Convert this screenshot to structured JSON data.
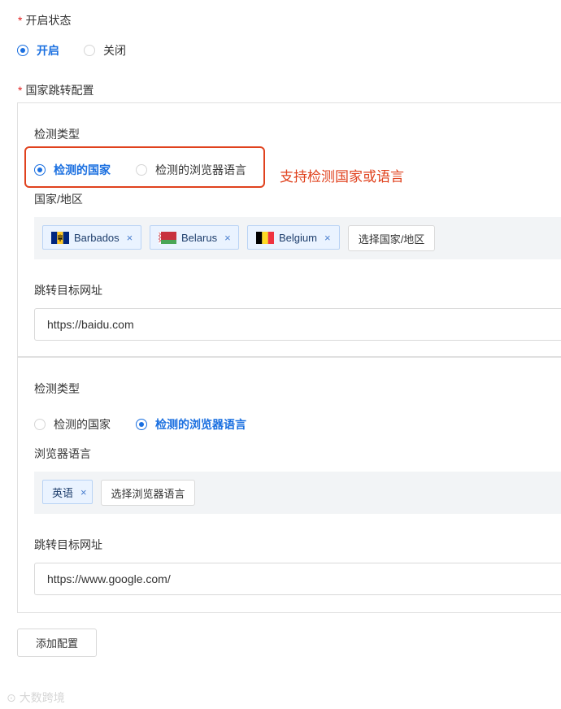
{
  "status_section": {
    "required_mark": "*",
    "label": "开启状态",
    "options": [
      {
        "label": "开启",
        "checked": true
      },
      {
        "label": "关闭",
        "checked": false
      }
    ]
  },
  "country_jump_section": {
    "required_mark": "*",
    "label": "国家跳转配置"
  },
  "configs": [
    {
      "detect_type_label": "检测类型",
      "detect_options": [
        {
          "label": "检测的国家",
          "checked": true
        },
        {
          "label": "检测的浏览器语言",
          "checked": false
        }
      ],
      "selection_label": "国家/地区",
      "tags": [
        {
          "label": "Barbados",
          "flag_icon": "barbados-flag-icon",
          "close": "×"
        },
        {
          "label": "Belarus",
          "flag_icon": "belarus-flag-icon",
          "close": "×"
        },
        {
          "label": "Belgium",
          "flag_icon": "belgium-flag-icon",
          "close": "×"
        }
      ],
      "select_button": "选择国家/地区",
      "target_url_label": "跳转目标网址",
      "target_url_value": "https://baidu.com"
    },
    {
      "detect_type_label": "检测类型",
      "detect_options": [
        {
          "label": "检测的国家",
          "checked": false
        },
        {
          "label": "检测的浏览器语言",
          "checked": true
        }
      ],
      "selection_label": "浏览器语言",
      "tags": [
        {
          "label": "英语",
          "close": "×"
        }
      ],
      "select_button": "选择浏览器语言",
      "target_url_label": "跳转目标网址",
      "target_url_value": "https://www.google.com/"
    }
  ],
  "add_config_button": "添加配置",
  "annotation_text": "支持检测国家或语言",
  "watermark": "大数跨境",
  "colors": {
    "accent": "#1a6fe0",
    "annotation_red": "#e0421e",
    "required_red": "#e02020"
  }
}
